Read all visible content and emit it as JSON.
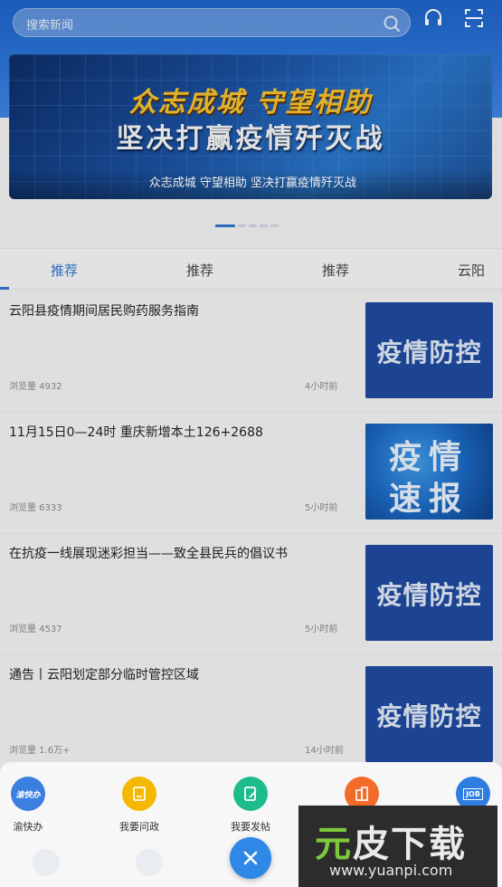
{
  "search": {
    "placeholder": "搜索新闻"
  },
  "header_icons": [
    "headphones-icon",
    "scan-icon"
  ],
  "banner": {
    "line1": "众志成城 守望相助",
    "line2": "坚决打赢疫情歼灭战",
    "caption": "众志成城 守望相助 坚决打赢疫情歼灭战"
  },
  "tabs": [
    {
      "label": "推荐",
      "active": true
    },
    {
      "label": "推荐",
      "active": false
    },
    {
      "label": "推荐",
      "active": false
    },
    {
      "label": "云阳",
      "active": false
    }
  ],
  "news": [
    {
      "title": "云阳县疫情期间居民购药服务指南",
      "views": "浏览量 4932",
      "time": "4小时前",
      "thumb_text": "疫情防控"
    },
    {
      "title": "11月15日0—24时 重庆新增本土126+2688",
      "views": "浏览量 6333",
      "time": "5小时前",
      "thumb_text_1": "疫情",
      "thumb_text_2": "速报"
    },
    {
      "title": "在抗疫一线展现迷彩担当——致全县民兵的倡议书",
      "views": "浏览量 4537",
      "time": "5小时前",
      "thumb_text": "疫情防控"
    },
    {
      "title": "通告丨云阳划定部分临时管控区域",
      "views": "浏览量 1.6万+",
      "time": "14小时前",
      "thumb_text": "疫情防控"
    }
  ],
  "actions": [
    {
      "label": "渝快办",
      "icon": "yukuaiban-icon",
      "badge": "渝快办",
      "color": "#3b7fe0"
    },
    {
      "label": "我要问政",
      "icon": "notepad-icon",
      "color": "#f5b800"
    },
    {
      "label": "我要发帖",
      "icon": "edit-icon",
      "color": "#1ebc8c"
    },
    {
      "label": "",
      "icon": "building-icon",
      "color": "#f26b2a"
    },
    {
      "label": "",
      "icon": "job-icon",
      "badge": "JOB",
      "color": "#2f7de0"
    }
  ],
  "close_icon": "close-icon",
  "watermark": {
    "text_1": "元",
    "text_2": "皮下载",
    "url": "www.yuanpi.com"
  }
}
